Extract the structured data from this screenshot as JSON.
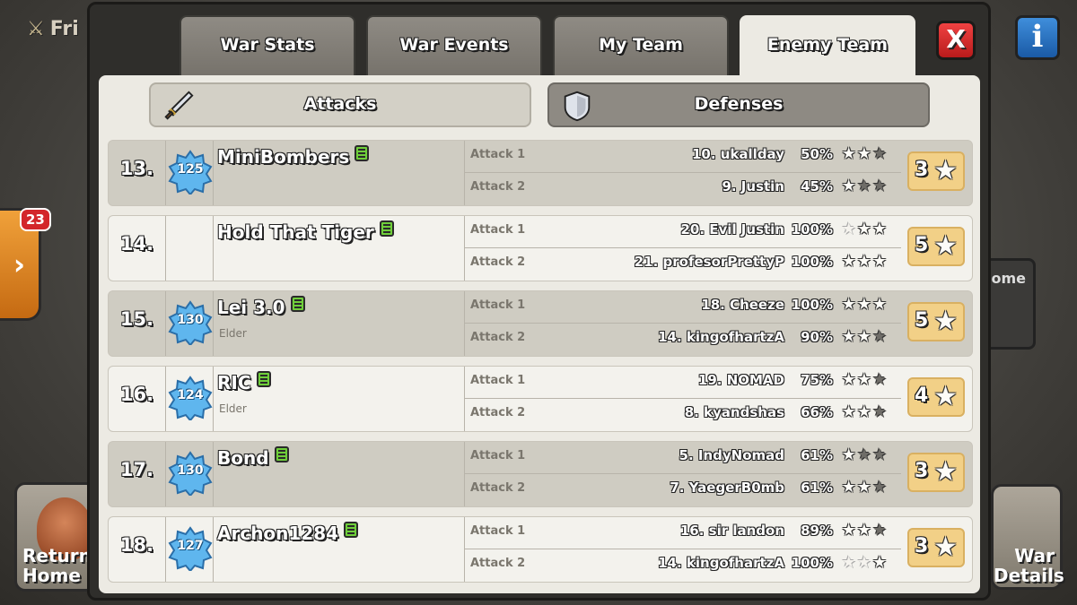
{
  "background": {
    "top_left_label": "Fri",
    "side_badge": "23",
    "return_home_label": "Return Home",
    "right_home_label": "ome",
    "war_details_label": "War Details"
  },
  "tabs": [
    {
      "label": "War Stats",
      "active": false
    },
    {
      "label": "War Events",
      "active": false
    },
    {
      "label": "My Team",
      "active": false
    },
    {
      "label": "Enemy Team",
      "active": true
    }
  ],
  "close_label": "X",
  "info_label": "i",
  "subtabs": {
    "attacks": "Attacks",
    "defenses": "Defenses"
  },
  "colors": {
    "accent_gold": "#f2d087",
    "close_red": "#d62b2b",
    "level_blue": "#4aa3e0"
  },
  "members": [
    {
      "rank": "13.",
      "level": "125",
      "name": "MiniBombers",
      "role": "",
      "attacks": [
        {
          "label": "Attack 1",
          "target": "10. ukallday",
          "percent": "50%",
          "stars": [
            1,
            1,
            0
          ]
        },
        {
          "label": "Attack 2",
          "target": "9. Justin",
          "percent": "45%",
          "stars": [
            1,
            0,
            0
          ]
        }
      ],
      "total_stars": "3"
    },
    {
      "rank": "14.",
      "level": "",
      "name": "Hold That Tiger",
      "role": "",
      "attacks": [
        {
          "label": "Attack 1",
          "target": "20. Evil Justin",
          "percent": "100%",
          "stars": [
            2,
            1,
            1
          ]
        },
        {
          "label": "Attack 2",
          "target": "21. profesorPrettyP",
          "percent": "100%",
          "stars": [
            1,
            1,
            1
          ]
        }
      ],
      "total_stars": "5"
    },
    {
      "rank": "15.",
      "level": "130",
      "name": "Lei 3.0",
      "role": "Elder",
      "attacks": [
        {
          "label": "Attack 1",
          "target": "18. Cheeze",
          "percent": "100%",
          "stars": [
            1,
            1,
            1
          ]
        },
        {
          "label": "Attack 2",
          "target": "14. kingofhartzA",
          "percent": "90%",
          "stars": [
            1,
            1,
            0
          ]
        }
      ],
      "total_stars": "5"
    },
    {
      "rank": "16.",
      "level": "124",
      "name": "RIC",
      "role": "Elder",
      "attacks": [
        {
          "label": "Attack 1",
          "target": "19. NOMAD",
          "percent": "75%",
          "stars": [
            1,
            1,
            0
          ]
        },
        {
          "label": "Attack 2",
          "target": "8. kyandshas",
          "percent": "66%",
          "stars": [
            1,
            1,
            0
          ]
        }
      ],
      "total_stars": "4"
    },
    {
      "rank": "17.",
      "level": "130",
      "name": "Bond",
      "role": "",
      "attacks": [
        {
          "label": "Attack 1",
          "target": "5. IndyNomad",
          "percent": "61%",
          "stars": [
            1,
            0,
            0
          ]
        },
        {
          "label": "Attack 2",
          "target": "7. YaegerB0mb",
          "percent": "61%",
          "stars": [
            1,
            1,
            0
          ]
        }
      ],
      "total_stars": "3"
    },
    {
      "rank": "18.",
      "level": "127",
      "name": "Archon1284",
      "role": "",
      "attacks": [
        {
          "label": "Attack 1",
          "target": "16. sir landon",
          "percent": "89%",
          "stars": [
            1,
            1,
            0
          ]
        },
        {
          "label": "Attack 2",
          "target": "14. kingofhartzA",
          "percent": "100%",
          "stars": [
            2,
            2,
            1
          ]
        }
      ],
      "total_stars": "3"
    }
  ]
}
